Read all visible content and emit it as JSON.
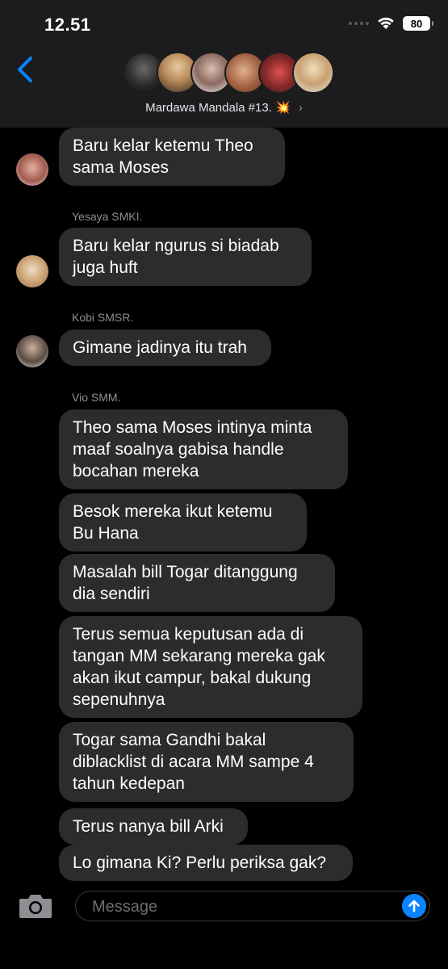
{
  "status_bar": {
    "time": "12.51",
    "battery": "80"
  },
  "header": {
    "group_name": "Mardawa Mandala #13.",
    "group_emoji": "💥",
    "chevron": "›"
  },
  "messages": [
    "Baru kelar ketemu Theo\nsama Moses",
    "Baru kelar ngurus si biadab\njuga huft",
    "Gimane jadinya itu trah",
    "Theo sama Moses intinya minta\nmaaf soalnya gabisa handle\nbocahan mereka",
    "Besok mereka ikut ketemu\nBu Hana",
    "Masalah bill Togar ditanggung\ndia sendiri",
    "Terus semua keputusan ada di\ntangan MM sekarang mereka gak\nakan ikut campur, bakal dukung\nsepenuhnya",
    "Togar sama Gandhi bakal\ndiblacklist di acara MM sampe 4\ntahun kedepan",
    "Terus nanya bill Arki",
    "Lo gimana Ki? Perlu periksa gak?"
  ],
  "senders": [
    "Yesaya SMKI.",
    "Kobi SMSR.",
    "Vio SMM."
  ],
  "composer": {
    "placeholder": "Message"
  },
  "colors": {
    "accent": "#0a84ff",
    "bubble": "#2c2c2e",
    "header_bg": "#1c1c1e"
  }
}
